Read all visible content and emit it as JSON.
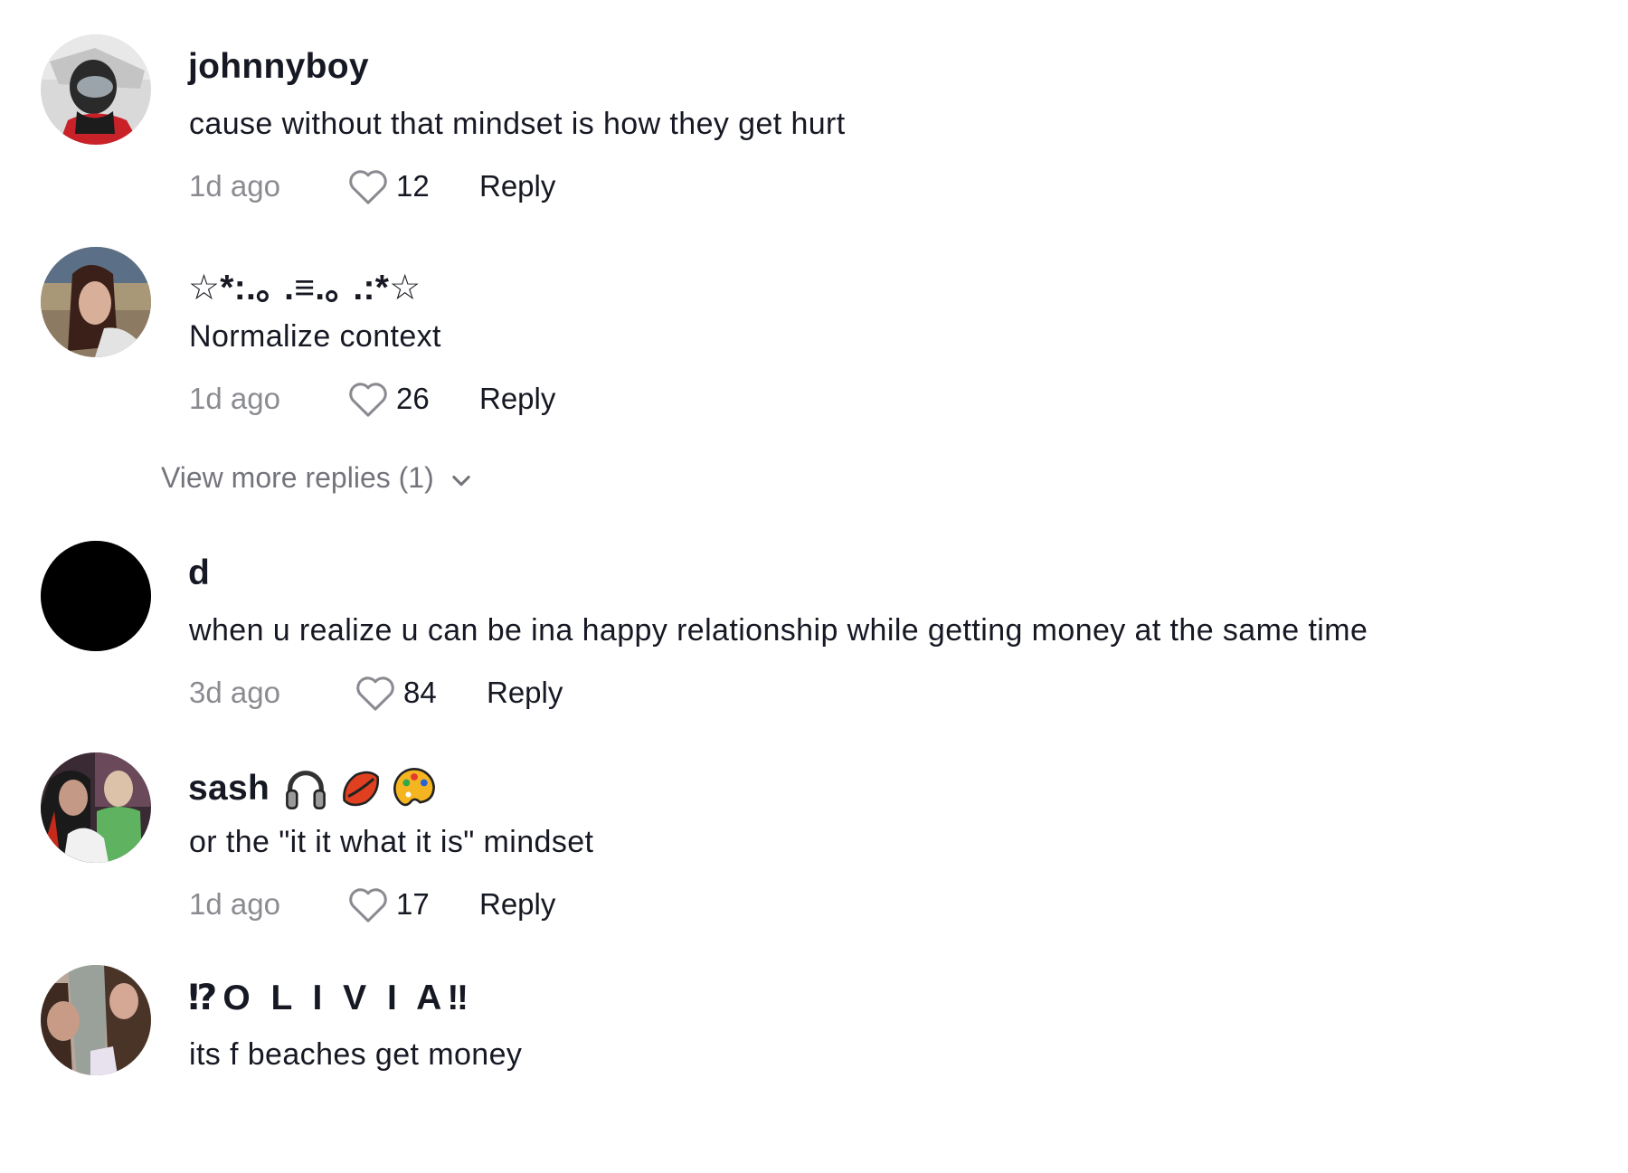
{
  "comments": [
    {
      "username": "johnnyboy",
      "text": "cause without that mindset is how they get hurt",
      "time": "1d ago",
      "likes": "12",
      "reply_label": "Reply",
      "avatar": "avatar-photo-helmet"
    },
    {
      "username": "☆*:.｡ .≡.｡ .:*☆",
      "text": "Normalize context",
      "time": "1d ago",
      "likes": "26",
      "reply_label": "Reply",
      "avatar": "avatar-photo-woman"
    },
    {
      "username": "d",
      "text": "when u realize u can be ina happy relationship while getting money at the same time",
      "time": "3d ago",
      "likes": "84",
      "reply_label": "Reply",
      "avatar": "avatar-black-circle"
    },
    {
      "username": "sash",
      "username_emojis": [
        "headphone-emoji",
        "lips-emoji",
        "palette-emoji"
      ],
      "text": "or the \"it it what it is\" mindset",
      "time": "1d ago",
      "likes": "17",
      "reply_label": "Reply",
      "avatar": "avatar-photo-two-people"
    },
    {
      "username": "⁉O L I V I A‼",
      "text": "its f beaches get money",
      "avatar": "avatar-photo-two-girls"
    }
  ],
  "view_more_replies": "View more replies (1)",
  "colors": {
    "text_primary": "#161823",
    "text_secondary": "rgba(22,24,35,0.5)",
    "heart_outline": "#8a8b91"
  }
}
